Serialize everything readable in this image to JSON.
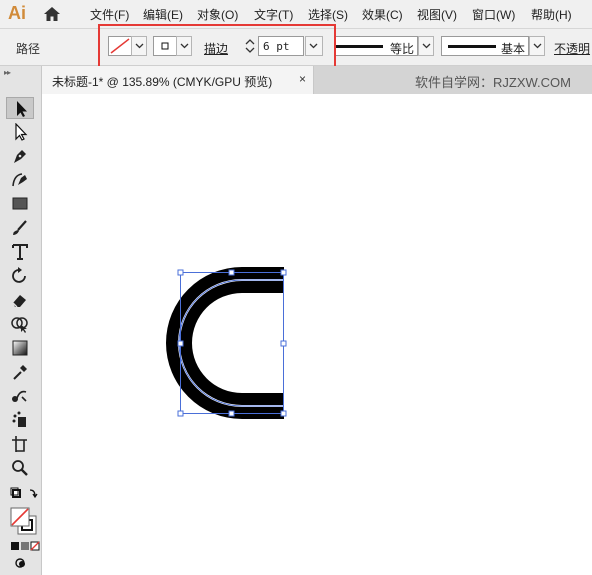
{
  "app": {
    "logo": "Ai"
  },
  "menu": {
    "items": [
      "文件(F)",
      "编辑(E)",
      "对象(O)",
      "文字(T)",
      "选择(S)",
      "效果(C)",
      "视图(V)",
      "窗口(W)",
      "帮助(H)"
    ]
  },
  "control_bar": {
    "selection_label": "路径",
    "stroke_label": "描边",
    "stroke_weight": "6 pt",
    "variable_width_label": "等比",
    "brush_label": "基本",
    "opacity_label": "不透明"
  },
  "document": {
    "tab_title": "未标题-1* @ 135.89% (CMYK/GPU 预览)",
    "close_glyph": "×"
  },
  "watermark": "软件自学网：RJZXW.COM",
  "colors": {
    "highlight": "#e53935",
    "selection": "#4a6fd8",
    "stroke": "#000000",
    "app_logo": "#d18b3a"
  },
  "tools": [
    "selection-tool",
    "direct-selection-tool",
    "pen-tool",
    "curvature-tool",
    "rectangle-tool",
    "paintbrush-tool",
    "type-tool",
    "rotate-tool",
    "eraser-tool",
    "shape-builder-tool",
    "gradient-tool",
    "eyedropper-tool",
    "blend-tool",
    "symbol-sprayer-tool",
    "artboard-tool",
    "zoom-tool"
  ]
}
